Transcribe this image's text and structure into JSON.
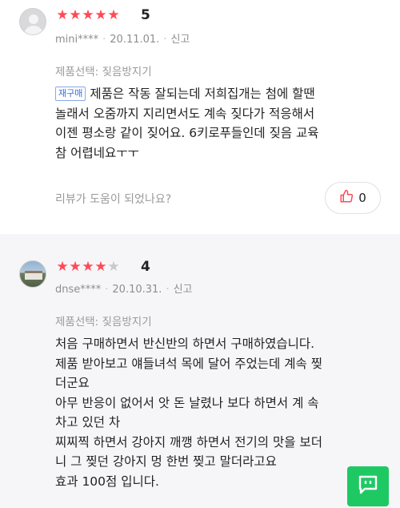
{
  "reviews": [
    {
      "rating_stars": 5,
      "rating_label": "5",
      "user": "mini****",
      "date": "20.11.01.",
      "report_label": "신고",
      "option": "제품선택: 짖음방지기",
      "badge": "재구매",
      "content_lines": [
        "제품은 작동 잘되는데 저희집개는 첨에 할땐",
        "놀래서 오줌까지 지리면서도 계속 짖다가 적응해서",
        "이젠 평소랑 같이 짖어요. 6키로푸들인데 짖음 교육",
        "참 어렵네요ㅜㅜ"
      ],
      "helpful_text": "리뷰가 도움이 되었나요?",
      "like_count": "0"
    },
    {
      "rating_stars": 4,
      "rating_label": "4",
      "user": "dnse****",
      "date": "20.10.31.",
      "report_label": "신고",
      "option": "제품선택: 짖음방지기",
      "content_lines": [
        "처음 구매하면서 반신반의 하면서 구매하였습니다.",
        "제품 받아보고 얘들녀석 목에 달어 주었는데 계속 찢",
        "더군요",
        "아무 반응이 없어서 앗 돈 날렸나 보다 하면서 계 속",
        "차고 있던 차",
        "찌찌찍 하면서 강아지 깨깽 하면서 전기의 맛을 보더",
        "니 그 찢던 강아지 멍 한번 찢고 말더라고요",
        "효과 100점 입니다."
      ]
    }
  ],
  "colors": {
    "star_filled": "#ff4a57",
    "star_empty": "#c9c9c9",
    "badge_blue": "#3a6fd8",
    "chat_green": "#1ec964"
  },
  "icons": {
    "like": "thumbs-up-icon",
    "chat": "chat-icon"
  }
}
